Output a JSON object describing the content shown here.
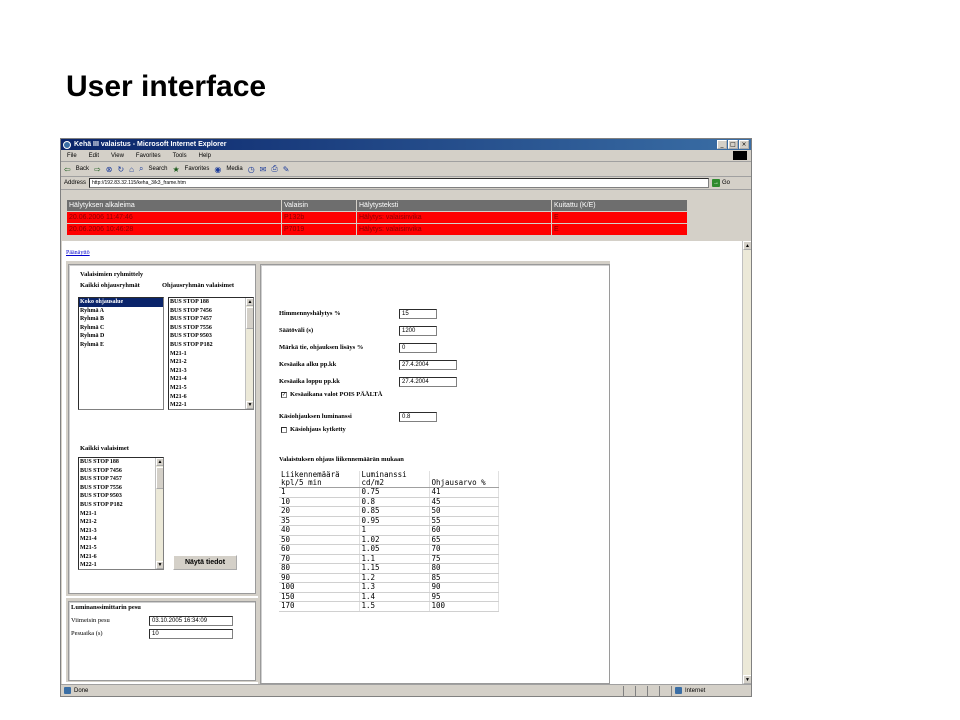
{
  "slide": {
    "title": "User interface"
  },
  "browser": {
    "window_title": "Kehä III valaistus - Microsoft Internet Explorer",
    "menu": [
      "File",
      "Edit",
      "View",
      "Favorites",
      "Tools",
      "Help"
    ],
    "toolbar": {
      "back": "Back",
      "search": "Search",
      "favorites": "Favorites",
      "media": "Media"
    },
    "address_label": "Address",
    "address": "http://192.83.32.115/keha_3/k3_frame.htm",
    "go": "Go",
    "status": "Done",
    "zone": "Internet"
  },
  "alarms": {
    "headers": [
      "Hälytyksen alkaleima",
      "Valaisin",
      "Hälytysteksti",
      "Kuitattu (K/E)"
    ],
    "rows": [
      [
        "20.06.2006 11:47:46",
        "P132b",
        "Hälytys: valaisinvika",
        "E"
      ],
      [
        "20.06.2006 10:46:28",
        "P7019",
        "Hälytys: valaisinvika",
        "E"
      ]
    ]
  },
  "nav": {
    "home_link": "Päänäyttö"
  },
  "grouping": {
    "title": "Valaisimien ryhmittely",
    "all_groups_label": "Kaikki ohjausryhmät",
    "group_lamps_label": "Ohjausryhmän valaisimet",
    "groups": [
      "Koko ohjausalue",
      "Ryhmä A",
      "Ryhmä B",
      "Ryhmä C",
      "Ryhmä D",
      "Ryhmä E"
    ],
    "group_lamps": [
      "BUS STOP 188",
      "BUS STOP 7456",
      "BUS STOP 7457",
      "BUS STOP 7556",
      "BUS STOP 9503",
      "BUS STOP P182",
      "M21-1",
      "M21-2",
      "M21-3",
      "M21-4",
      "M21-5",
      "M21-6",
      "M22-1"
    ],
    "all_lamps_label": "Kaikki valaisimet",
    "all_lamps": [
      "BUS STOP 188",
      "BUS STOP 7456",
      "BUS STOP 7457",
      "BUS STOP 7556",
      "BUS STOP 9503",
      "BUS STOP P182",
      "M21-1",
      "M21-2",
      "M21-3",
      "M21-4",
      "M21-5",
      "M21-6",
      "M22-1"
    ],
    "show_button": "Näytä tiedot"
  },
  "sensor": {
    "title": "Luminanssimittarin pesu",
    "last_wash_label": "Viimeisin pesu",
    "last_wash_value": "03.10.2005 16:34:09",
    "wash_time_label": "Pesuaika (s)",
    "wash_time_value": "10"
  },
  "settings": {
    "dim_alarm_label": "Himmennyshälytys %",
    "dim_alarm_value": "15",
    "interval_label": "Säätöväli (s)",
    "interval_value": "1200",
    "wet_road_label": "Märkä tie, ohjauksen lisäys %",
    "wet_road_value": "0",
    "summer_start_label": "Kesäaika alku pp.kk",
    "summer_start_value": "27.4.2004",
    "summer_end_label": "Kesäaika loppu pp.kk",
    "summer_end_value": "27.4.2004",
    "summer_off_label": "Kesäaikana valot POIS PÄÄLTÄ",
    "summer_off_checked": true,
    "manual_lum_label": "Käsiohjauksen luminanssi",
    "manual_lum_value": "0.8",
    "manual_enabled_label": "Käsiohjaus kytketty",
    "manual_enabled_checked": false,
    "traffic_title": "Valaistuksen ohjaus liikennemäärän mukaan",
    "traffic_headers": [
      "Liikennemäärä kpl/5 min",
      "Luminanssi cd/m2",
      "Ohjausarvo %"
    ],
    "traffic_rows": [
      [
        "1",
        "0.75",
        "41"
      ],
      [
        "10",
        "0.8",
        "45"
      ],
      [
        "20",
        "0.85",
        "50"
      ],
      [
        "35",
        "0.95",
        "55"
      ],
      [
        "40",
        "1",
        "60"
      ],
      [
        "50",
        "1.02",
        "65"
      ],
      [
        "60",
        "1.05",
        "70"
      ],
      [
        "70",
        "1.1",
        "75"
      ],
      [
        "80",
        "1.15",
        "80"
      ],
      [
        "90",
        "1.2",
        "85"
      ],
      [
        "100",
        "1.3",
        "90"
      ],
      [
        "150",
        "1.4",
        "95"
      ],
      [
        "170",
        "1.5",
        "100"
      ]
    ]
  }
}
